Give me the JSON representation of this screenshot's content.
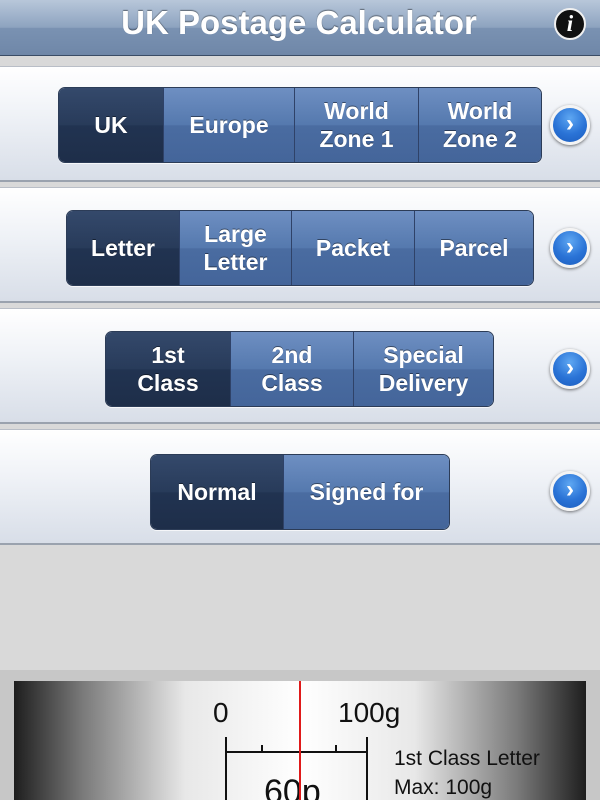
{
  "header": {
    "title": "UK Postage Calculator",
    "info_icon": "i"
  },
  "destination": {
    "options": [
      "UK",
      "Europe",
      "World\nZone 1",
      "World\nZone 2"
    ],
    "selected": "UK"
  },
  "size": {
    "options": [
      "Letter",
      "Large\nLetter",
      "Packet",
      "Parcel"
    ],
    "selected": "Letter"
  },
  "service": {
    "options": [
      "1st\nClass",
      "2nd\nClass",
      "Special\nDelivery"
    ],
    "selected": "1st Class"
  },
  "delivery": {
    "options": [
      "Normal",
      "Signed for"
    ],
    "selected": "Normal"
  },
  "gauge": {
    "scale_start": "0",
    "scale_end": "100g",
    "price": "60p",
    "service_label": "1st Class Letter",
    "max_label": "Max: 100g",
    "needle_color": "#e01b1b"
  },
  "colors": {
    "segment_selected": "#223453",
    "segment_normal": "#5071a8",
    "chevron": "#2a73d6"
  },
  "icons": {
    "info": "info-icon",
    "chevron": "chevron-right-icon"
  }
}
